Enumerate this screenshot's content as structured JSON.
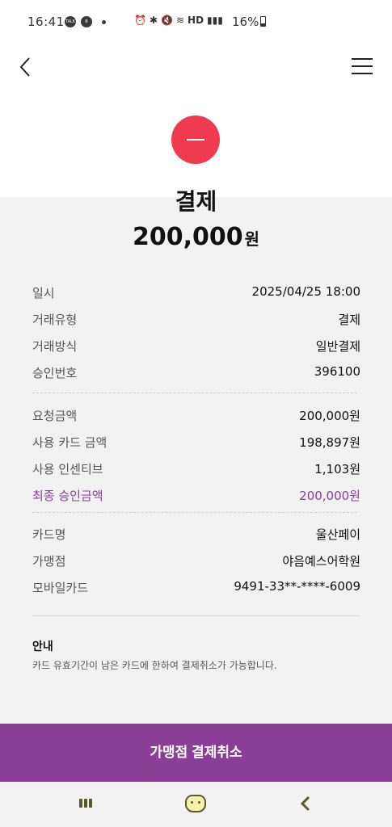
{
  "status_bar": {
    "time": "16:41",
    "battery": "16%",
    "network_label": "HD"
  },
  "header": {
    "title": "결제",
    "amount": "200,000",
    "amount_unit": "원"
  },
  "details_group1": [
    {
      "label": "일시",
      "value": "2025/04/25 18:00"
    },
    {
      "label": "거래유형",
      "value": "결제"
    },
    {
      "label": "거래방식",
      "value": "일반결제"
    },
    {
      "label": "승인번호",
      "value": "396100"
    }
  ],
  "details_group2": [
    {
      "label": "요청금액",
      "value": "200,000원"
    },
    {
      "label": "사용 카드 금액",
      "value": "198,897원"
    },
    {
      "label": "사용 인센티브",
      "value": "1,103원"
    },
    {
      "label": "최종 승인금액",
      "value": "200,000원"
    }
  ],
  "details_group3": [
    {
      "label": "카드명",
      "value": "울산페이"
    },
    {
      "label": "가맹점",
      "value": "야음예스어학원"
    },
    {
      "label": "모바일카드",
      "value": "9491-33**-****-6009"
    }
  ],
  "notice": {
    "title": "안내",
    "text": "카드 유효기간이 남은 카드에 한하여 결제취소가 가능합니다."
  },
  "cancel_button": {
    "label": "가맹점 결제취소"
  },
  "colors": {
    "accent": "#8a3f97",
    "status_icon": "#ef3a4f",
    "highlight": "#8a3d9a"
  },
  "icons": [
    "back-icon",
    "menu-icon",
    "minus-icon",
    "recents-icon",
    "home-icon",
    "nav-back-icon"
  ]
}
